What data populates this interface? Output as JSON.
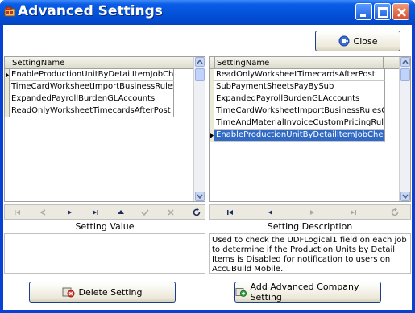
{
  "window": {
    "title": "Advanced Settings",
    "accent_color": "#0a5ce6"
  },
  "toolbar": {
    "close_label": "Close"
  },
  "left_grid": {
    "column_header": "SettingName",
    "rows": [
      "EnableProductionUnitByDetailItemJobCheck",
      "TimeCardWorksheetImportBusinessRulesCheck",
      "ExpandedPayrollBurdenGLAccounts",
      "ReadOnlyWorksheetTimecardsAfterPost"
    ],
    "current_row_index": 0
  },
  "right_grid": {
    "column_header": "SettingName",
    "rows": [
      "ReadOnlyWorksheetTimecardsAfterPost",
      "SubPaymentSheetsPayBySub",
      "ExpandedPayrollBurdenGLAccounts",
      "TimeCardWorksheetImportBusinessRulesCheck",
      "TimeAndMaterialInvoiceCustomPricingRules",
      "EnableProductionUnitByDetailItemJobCheck"
    ],
    "selected_row_index": 5,
    "selection_color": "#316ac5"
  },
  "left_panel": {
    "label": "Setting Value",
    "value": "",
    "button_label": "Delete Setting"
  },
  "right_panel": {
    "label": "Setting Description",
    "description": "Used to check the UDFLogical1 field on each job to determine if the Production Units by Detail Items is Disabled for notification to users on AccuBuild Mobile.",
    "button_label": "Add Advanced Company Setting"
  }
}
